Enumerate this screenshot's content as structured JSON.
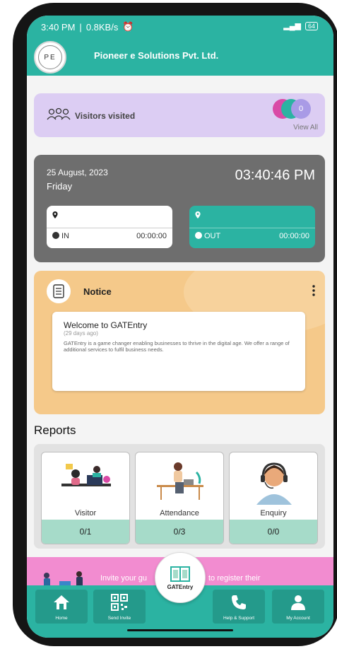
{
  "status_bar": {
    "time": "3:40 PM",
    "speed": "0.8KB/s",
    "battery": "64"
  },
  "header": {
    "logo_text": "PE",
    "company": "Pioneer e Solutions Pvt. Ltd."
  },
  "visitors": {
    "label": "Visitors visited",
    "count": "0",
    "view_all": "View All"
  },
  "attendance": {
    "date": "25 August, 2023",
    "day": "Friday",
    "clock": "03:40:46 PM",
    "in_label": "IN",
    "in_time": "00:00:00",
    "out_label": "OUT",
    "out_time": "00:00:00"
  },
  "notice": {
    "title": "Notice",
    "item_title": "Welcome to GATEntry",
    "item_ago": "(29 days ago)",
    "item_body": "GATEntry is a game changer enabling businesses to thrive in the digital age. We offer a range of additional services to fulfil business needs."
  },
  "reports": {
    "title": "Reports",
    "cards": [
      {
        "label": "Visitor",
        "count": "0/1"
      },
      {
        "label": "Attendance",
        "count": "0/3"
      },
      {
        "label": "Enquiry",
        "count": "0/0"
      }
    ]
  },
  "invite": {
    "text_left": "Invite your gu",
    "text_right": "to register their"
  },
  "fab": {
    "label": "GATEntry"
  },
  "nav": {
    "items": [
      {
        "label": "Home",
        "icon": "home-icon"
      },
      {
        "label": "Send Invite",
        "icon": "qr-icon"
      },
      {
        "label": "Help & Support",
        "icon": "phone-icon"
      },
      {
        "label": "My Account",
        "icon": "account-icon"
      }
    ]
  },
  "colors": {
    "teal": "#2bb3a2",
    "lavender": "#dccdf3",
    "notice": "#f5c98a",
    "pink": "#f28cd0",
    "mint": "#a6dbc9"
  }
}
